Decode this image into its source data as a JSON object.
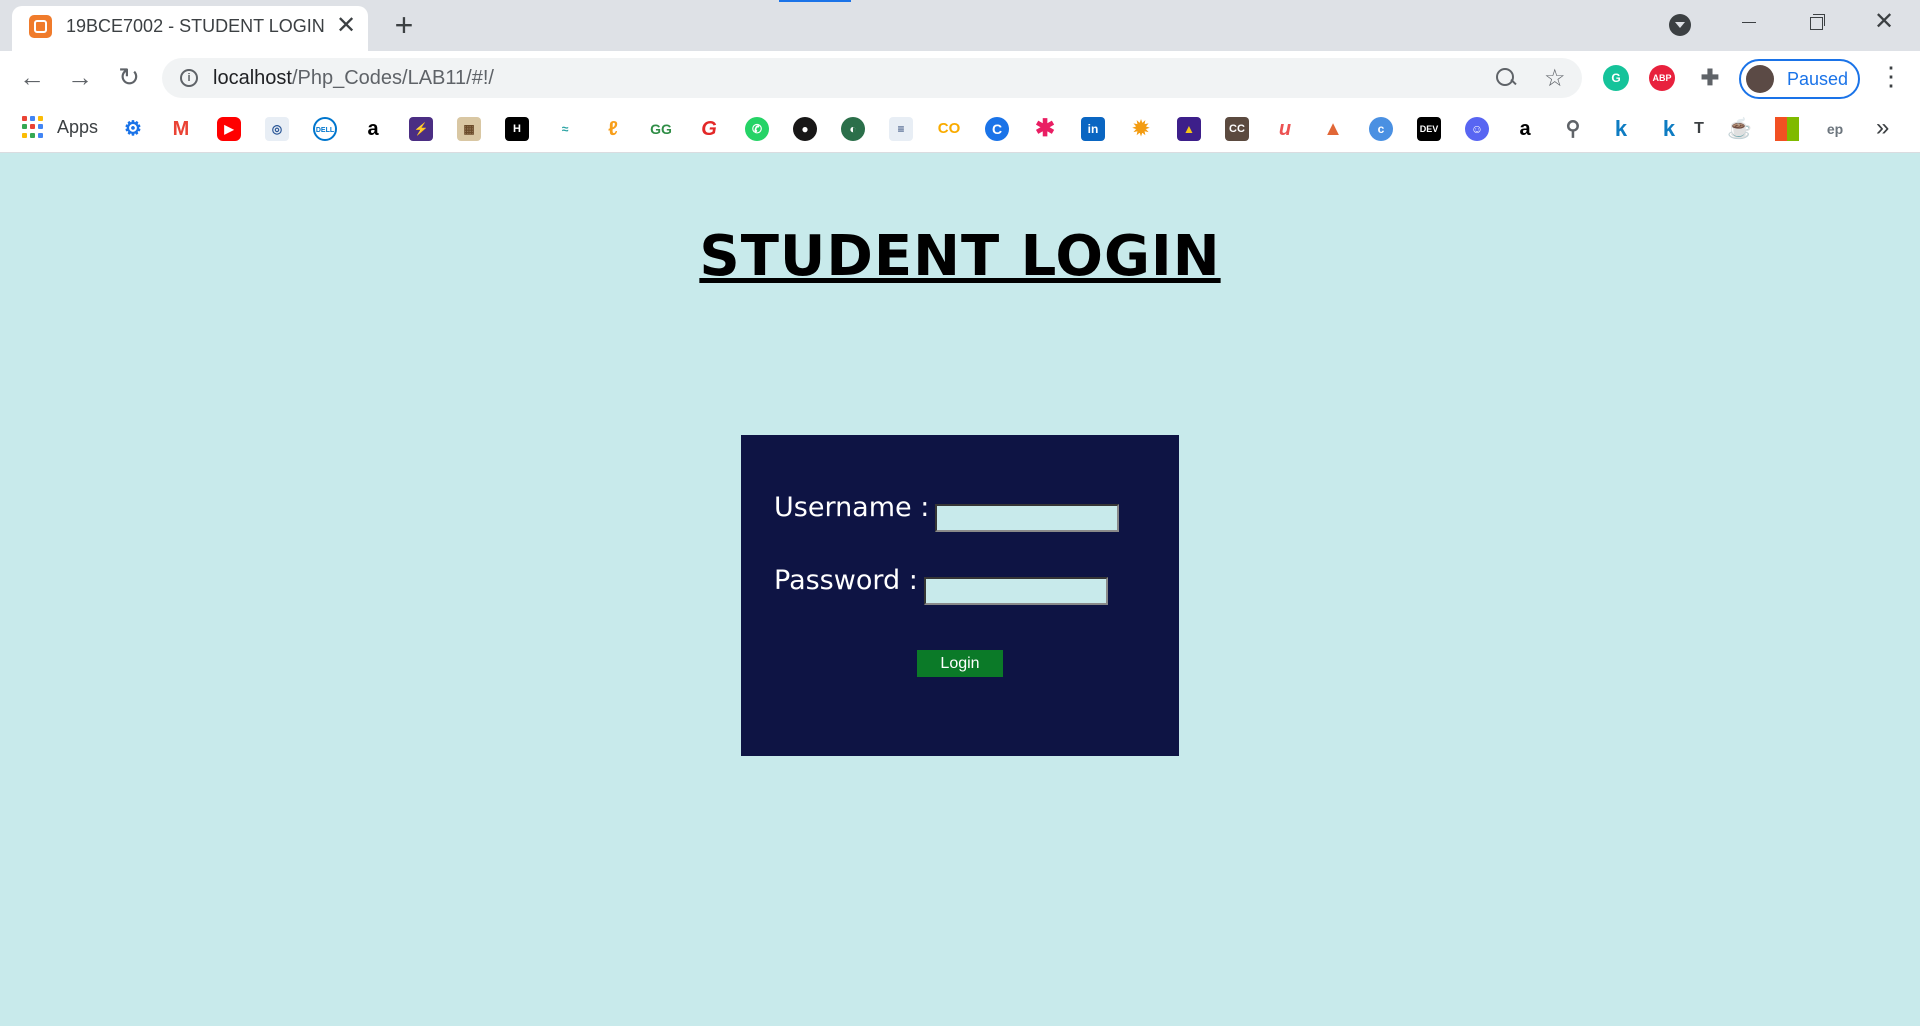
{
  "browser": {
    "tab": {
      "title": "19BCE7002 - STUDENT LOGIN",
      "close_glyph": "✕"
    },
    "new_tab_glyph": "+",
    "url_host": "localhost",
    "url_path": "/Php_Codes/LAB11/#!/",
    "profile_label": "Paused",
    "menu_glyph": "⋮",
    "close_window_glyph": "✕"
  },
  "bookmarks": {
    "apps_label": "Apps",
    "overflow_glyph": "»",
    "items": [
      "settings",
      "gmail",
      "youtube",
      "site",
      "dell",
      "amazon",
      "bolt",
      "image",
      "hackerearth",
      "graph",
      "leetcode",
      "geeksforgeeks",
      "grammarly",
      "whatsapp",
      "github",
      "coursera",
      "notes",
      "coursera-co",
      "chrome-c",
      "asterisk",
      "linkedin",
      "sun",
      "data",
      "cc",
      "udemy",
      "matlab",
      "c-icon",
      "dev",
      "discord",
      "amazon",
      "search",
      "k",
      "k",
      "T",
      "java",
      "microsoft",
      "ep"
    ]
  },
  "page": {
    "title": "STUDENT LOGIN",
    "username_label": "Username :",
    "password_label": "Password :",
    "username_value": "",
    "password_value": "",
    "login_label": "Login"
  },
  "colors": {
    "page_background": "#c8eaeb",
    "login_box": "#0e1444",
    "login_button": "#0b7a28",
    "input_background": "#c8eaeb"
  }
}
